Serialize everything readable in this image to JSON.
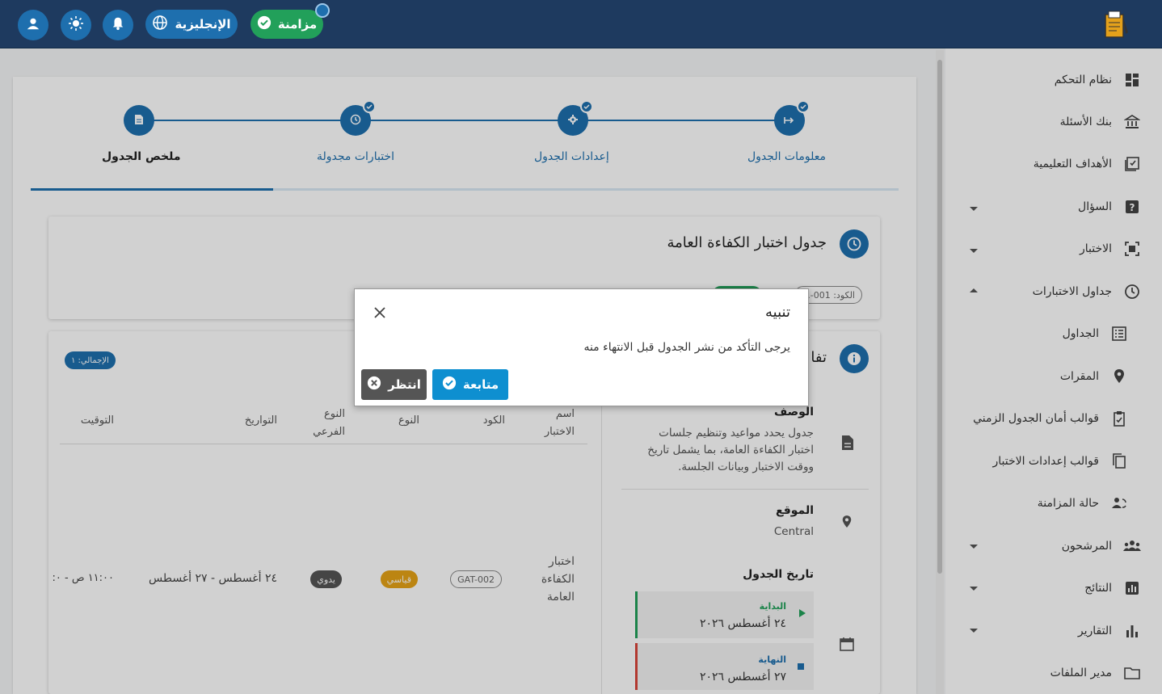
{
  "topbar": {
    "sync_label": "مزامنة",
    "language_label": "الإنجليزية",
    "icons": [
      "user-icon",
      "sun-icon",
      "bell-icon",
      "globe-icon",
      "check-icon"
    ]
  },
  "sidebar": {
    "items": [
      {
        "label": "نظام التحكم",
        "icon": "dashboard-icon"
      },
      {
        "label": "بنك الأسئلة",
        "icon": "bank-icon"
      },
      {
        "label": "الأهداف التعليمية",
        "icon": "goals-icon"
      },
      {
        "label": "السؤال",
        "icon": "question-icon"
      },
      {
        "label": "الاختبار",
        "icon": "exam-icon"
      },
      {
        "label": "جداول الاختبارات",
        "icon": "clock-icon"
      },
      {
        "label": "الجداول",
        "icon": "list-icon"
      },
      {
        "label": "المقرات",
        "icon": "pin-icon"
      },
      {
        "label": "قوالب أمان الجدول الزمني",
        "icon": "clipboard-icon"
      },
      {
        "label": "قوالب إعدادات الاختبار",
        "icon": "copy-icon"
      },
      {
        "label": "حالة المزامنة",
        "icon": "sync-icon"
      },
      {
        "label": "المرشحون",
        "icon": "people-icon"
      },
      {
        "label": "النتائج",
        "icon": "results-icon"
      },
      {
        "label": "التقارير",
        "icon": "reports-icon"
      },
      {
        "label": "مدير الملفات",
        "icon": "folder-icon"
      }
    ]
  },
  "stepper": {
    "steps": [
      "معلومات الجدول",
      "إعدادات الجدول",
      "اختبارات مجدولة",
      "ملخص الجدول"
    ]
  },
  "schedule": {
    "title": "جدول اختبار الكفاءة العامة",
    "code_label": "الكود: 001-..."
  },
  "details": {
    "section_title": "تفا",
    "total_badge": "الإجمالي: ١",
    "description_label": "الوصف",
    "description_text": "جدول يحدد مواعيد وتنظيم جلسات اختبار الكفاءة العامة، بما يشمل تاريخ ووقت الاختبار وبيانات الجلسة.",
    "location_label": "الموقع",
    "location_value": "Central",
    "date_label": "تاريخ الجدول",
    "start_label": "البداية",
    "start_value": "٢٤ أغسطس ٢٠٢٦",
    "end_label": "النهاية",
    "end_value": "٢٧ أغسطس ٢٠٢٦"
  },
  "table": {
    "headers": {
      "name": "اسم الاختبار",
      "code": "الكود",
      "type": "النوع",
      "subtype": "النوع الفرعي",
      "dates": "التواريخ",
      "time": "التوقيت"
    },
    "row": {
      "name": "اختبار الكفاءة العامة",
      "code": "GAT-002",
      "type": "قياسي",
      "subtype": "يدوي",
      "dates": "٢٤ أغسطس - ٢٧ أغسطس",
      "time": "١١:٠٠ ص - ٠:"
    }
  },
  "dialog": {
    "title": "تنبيه",
    "message": "يرجى التأكد من نشر الجدول قبل الانتهاء منه",
    "continue_label": "متابعة",
    "wait_label": "انتظر"
  },
  "colors": {
    "primary": "#1e6fae",
    "topbar": "#1e3a5f",
    "sync": "#22a05a",
    "continue": "#0e8fd0",
    "wait": "#555555",
    "standard_badge": "#e6a317"
  }
}
